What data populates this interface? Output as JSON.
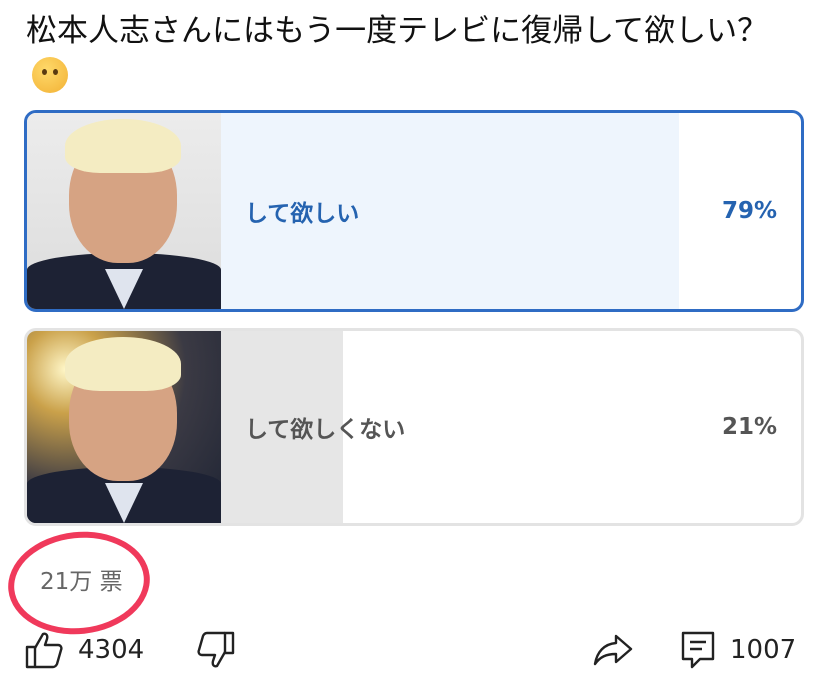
{
  "poll": {
    "question": "松本人志さんにはもう一度テレビに復帰して欲しい？",
    "emoji_icon": "thinking-face-emoji",
    "options": [
      {
        "label": "して欲しい",
        "percent_text": "79%",
        "percent": 79,
        "selected": true,
        "accent": "#2f6cc4"
      },
      {
        "label": "して欲しくない",
        "percent_text": "21%",
        "percent": 21,
        "selected": false,
        "accent": "#555555"
      }
    ],
    "votes_text": "21万 票"
  },
  "actions": {
    "like_count": "4304",
    "comment_count": "1007",
    "icons": [
      "thumbs-up-icon",
      "thumbs-down-icon",
      "share-icon",
      "comment-icon"
    ]
  },
  "annotation_color": "#f0395b"
}
